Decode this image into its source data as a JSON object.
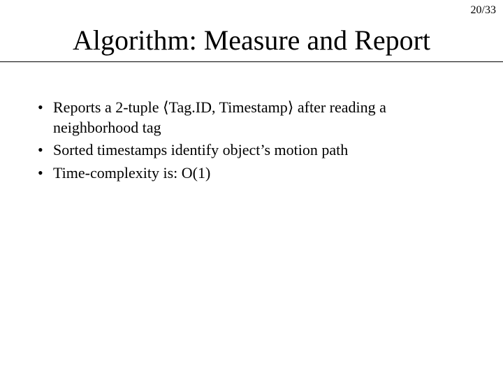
{
  "meta": {
    "page_number": "20/33"
  },
  "title": "Algorithm: Measure and Report",
  "bullets": [
    "Reports a 2-tuple ⟨Tag.ID, Timestamp⟩ after reading a neighborhood tag",
    "Sorted timestamps identify object’s motion path",
    "Time-complexity is: O(1)"
  ]
}
